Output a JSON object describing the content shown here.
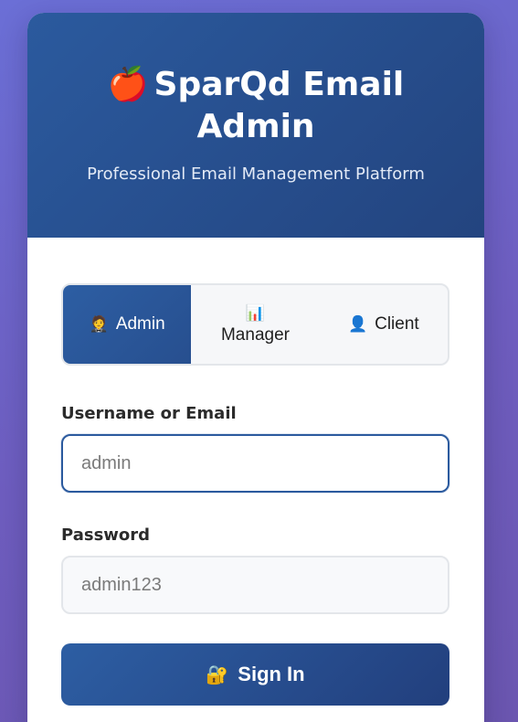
{
  "header": {
    "logo_icon": "🍎",
    "title": "SparQd Email Admin",
    "subtitle": "Professional Email Management Platform"
  },
  "roles": [
    {
      "icon": "🤵",
      "icon_name": "admin-icon",
      "label": "Admin",
      "active": true
    },
    {
      "icon": "📊",
      "icon_name": "chart-icon",
      "label": "Manager",
      "active": false
    },
    {
      "icon": "👤",
      "icon_name": "user-icon",
      "label": "Client",
      "active": false
    }
  ],
  "form": {
    "username_label": "Username or Email",
    "username_placeholder": "admin",
    "password_label": "Password",
    "password_placeholder": "admin123",
    "signin_icon": "🔐",
    "signin_label": "Sign In"
  },
  "colors": {
    "accent": "#2b5a9e",
    "header_dark": "#23447f",
    "background": "#6e5dbf"
  }
}
